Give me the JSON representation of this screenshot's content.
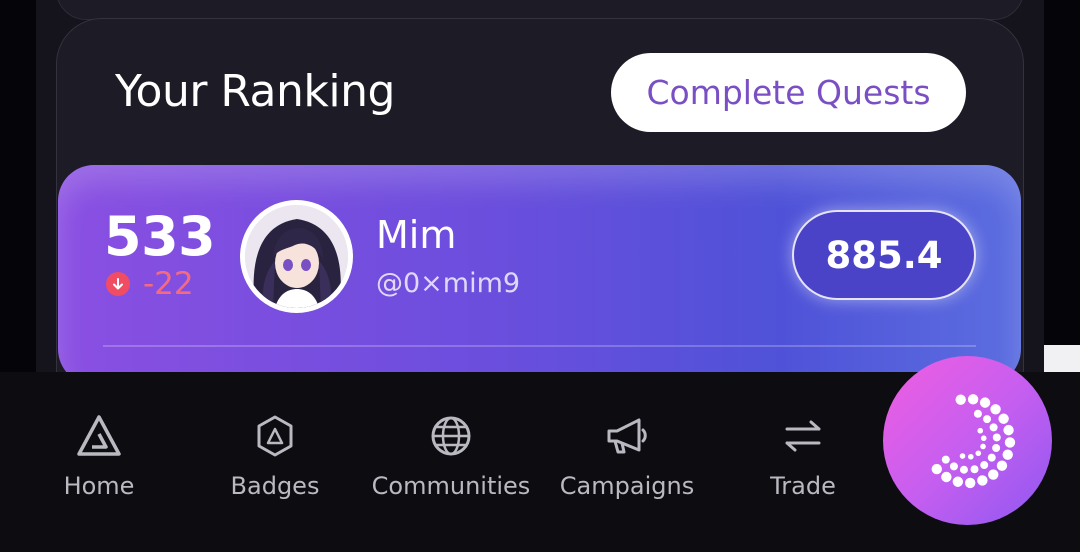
{
  "ranking": {
    "title": "Your Ranking",
    "quests_button": "Complete Quests"
  },
  "user_rank": {
    "rank": "533",
    "change": "-22",
    "change_direction": "down",
    "name": "Mim",
    "handle": "@0×mim9",
    "score": "885.4"
  },
  "nav": {
    "items": [
      {
        "label": "Home",
        "icon": "home-triangle-icon"
      },
      {
        "label": "Badges",
        "icon": "badge-hexagon-icon"
      },
      {
        "label": "Communities",
        "icon": "globe-icon"
      },
      {
        "label": "Campaigns",
        "icon": "megaphone-icon"
      },
      {
        "label": "Trade",
        "icon": "swap-arrows-icon"
      }
    ]
  },
  "colors": {
    "accent_purple": "#7a4fc4",
    "rank_down": "#f04d64",
    "panel_gradient_start": "#8a4fe2",
    "panel_gradient_end": "#5c6ee0",
    "fab_gradient_start": "#f05ee0",
    "fab_gradient_end": "#8d58f0"
  }
}
